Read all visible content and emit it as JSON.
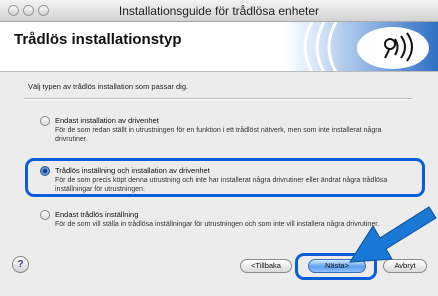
{
  "window": {
    "title": "Installationsguide för trådlösa enheter"
  },
  "header": {
    "title": "Trådlös installationstyp"
  },
  "intro": "Välj typen av trådlös installation som passar dig.",
  "options": [
    {
      "label": "Endast installation av drivenhet",
      "description": "För de som redan ställt in utrustningen för en funktion i ett trådlöst nätverk, men som inte installerat några drivrutiner.",
      "selected": false
    },
    {
      "label": "Trådlös inställning och installation av drivenhet",
      "description": "För de som precis köpt denna utrustning och inte har installerat några drivrutiner eller ändrat några trådlösa inställningar för utrustningen.",
      "selected": true
    },
    {
      "label": "Endast trådlös inställning",
      "description": "För de som vill ställa in trådlösa inställningar för utrustningen och som inte vill installera några drivrutiner.",
      "selected": false
    }
  ],
  "buttons": {
    "help": "?",
    "back": "<Tillbaka",
    "next": "Nästa>",
    "cancel": "Avbryt"
  },
  "colors": {
    "highlight": "#0a5ed7",
    "arrow": "#1a78d6"
  }
}
